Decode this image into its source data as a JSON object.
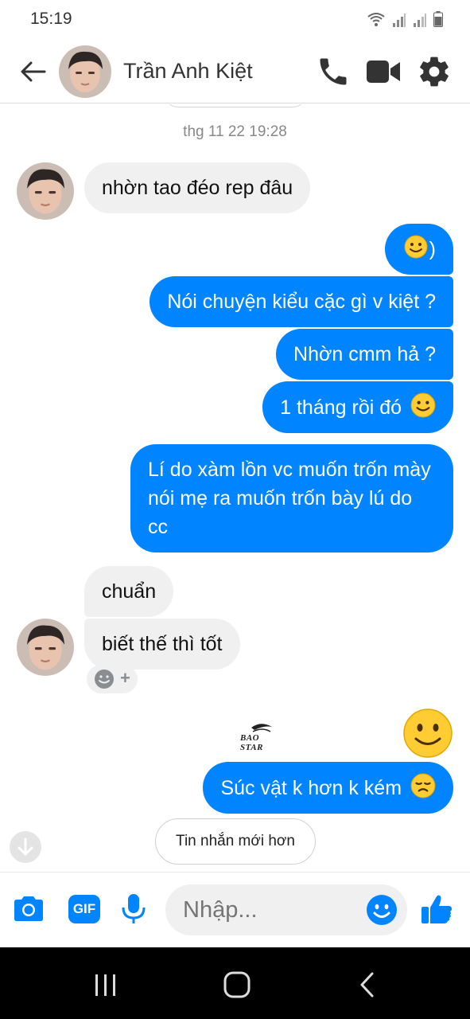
{
  "status_bar": {
    "time": "15:19"
  },
  "header": {
    "contact_name": "Trần Anh Kiệt"
  },
  "chat": {
    "timestamp": "thg 11 22 19:28",
    "messages": [
      {
        "from": "them",
        "text": "nhờn tao đéo rep đâu"
      },
      {
        "from": "me",
        "text": ")"
      },
      {
        "from": "me",
        "text": "Nói chuyện kiểu cặc gì v kiệt ?"
      },
      {
        "from": "me",
        "text": "Nhờn cmm hả ?"
      },
      {
        "from": "me",
        "text": "1 tháng rồi đó"
      },
      {
        "from": "me",
        "text": "Lí do xàm lồn vc muốn trốn mày nói mẹ ra muốn trốn bày lú do cc"
      },
      {
        "from": "them",
        "text": "chuẩn"
      },
      {
        "from": "them",
        "text": "biết thế thì tốt"
      },
      {
        "from": "me",
        "text": "Súc vật k hơn k kém"
      }
    ],
    "react_plus": "+",
    "watermark": "BAO STAR",
    "new_messages_pill": "Tin nhắn mới hơn"
  },
  "composer": {
    "gif_label": "GIF",
    "placeholder": "Nhập..."
  },
  "colors": {
    "accent": "#0084ff",
    "received_bubble": "#f0f0f0",
    "emoji": "#ffcc33"
  }
}
